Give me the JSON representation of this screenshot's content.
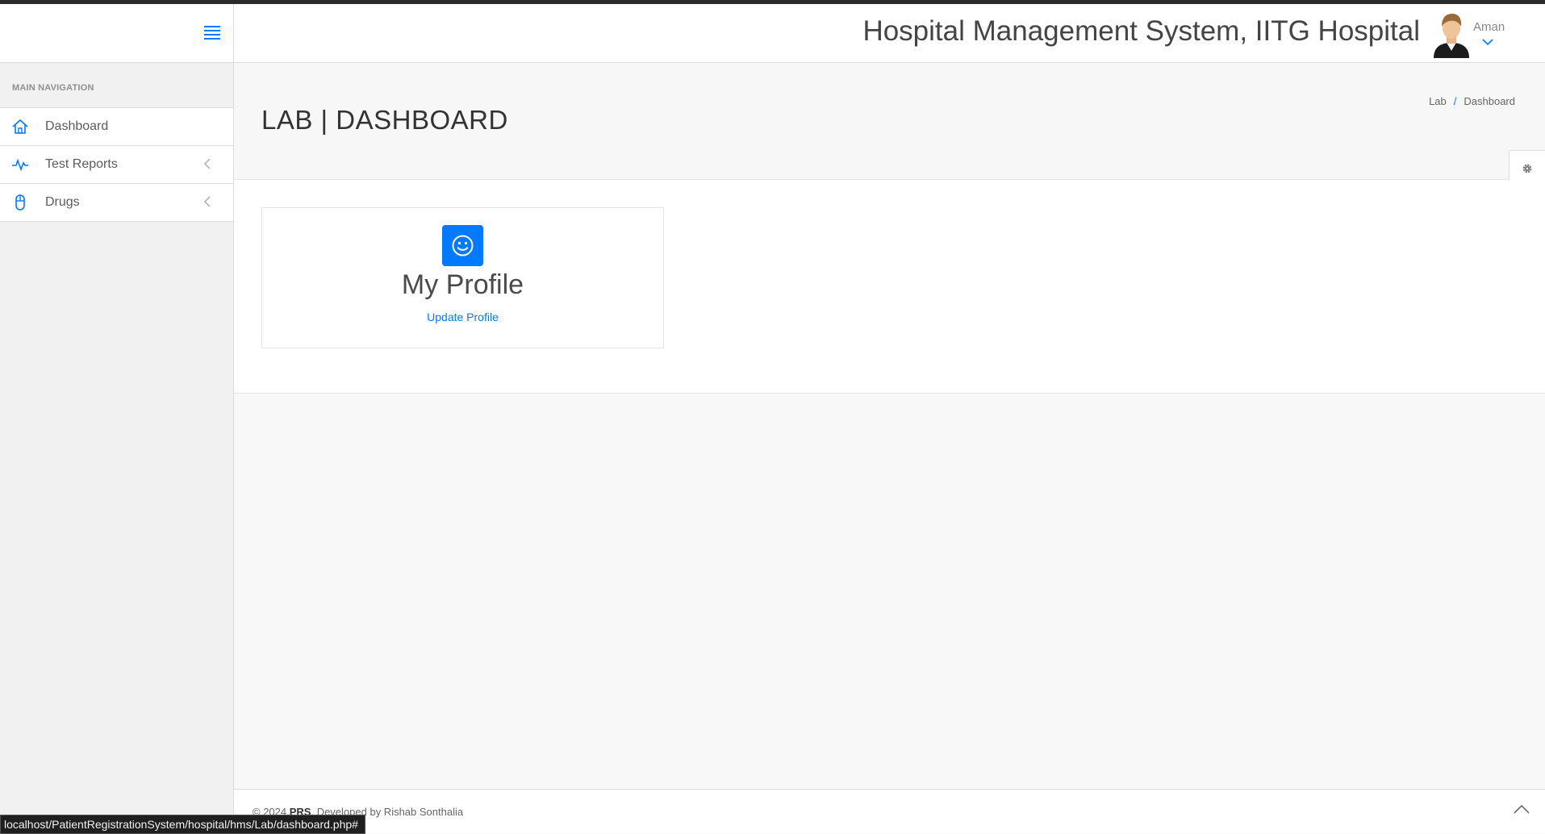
{
  "header": {
    "title": "Hospital Management System, IITG Hospital",
    "user_name": "Aman",
    "icons": [
      "menu-icon",
      "avatar",
      "chevron-down-icon"
    ]
  },
  "sidebar": {
    "heading": "MAIN NAVIGATION",
    "items": [
      {
        "label": "Dashboard",
        "icon": "home-icon"
      },
      {
        "label": "Test Reports",
        "icon": "pulse-icon",
        "expandable": true
      },
      {
        "label": "Drugs",
        "icon": "mouse-icon",
        "expandable": true
      }
    ]
  },
  "page": {
    "title": "LAB | DASHBOARD",
    "breadcrumb": [
      "Lab",
      "Dashboard"
    ]
  },
  "card": {
    "icon": "smile-icon",
    "title": "My Profile",
    "link": "Update Profile"
  },
  "footer": {
    "copyright": "© 2024 ",
    "brand": "PRS",
    "developer": ". Developed by Rishab Sonthalia"
  },
  "status_bar": {
    "url": "localhost/PatientRegistrationSystem/hospital/hms/Lab/dashboard.php#"
  },
  "colors": {
    "accent": "#007aff",
    "sidebar_bg": "#f1f1f1",
    "content_bg": "#ffffff"
  }
}
